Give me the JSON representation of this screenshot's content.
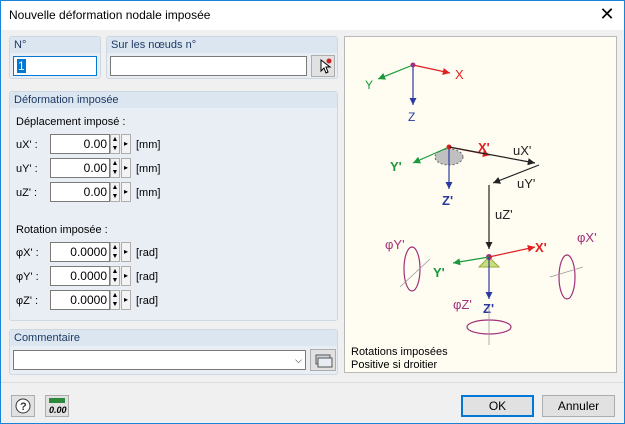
{
  "window": {
    "title": "Nouvelle déformation nodale imposée"
  },
  "no_group": {
    "label": "N°",
    "value": "1"
  },
  "nodes_group": {
    "label": "Sur les nœuds n°",
    "value": ""
  },
  "deformation_group": {
    "label": "Déformation imposée",
    "displacement_label": "Déplacement imposé :",
    "rotation_label": "Rotation imposée :",
    "rows": [
      {
        "symbol": "uX' :",
        "value": "0.00",
        "unit": "[mm]"
      },
      {
        "symbol": "uY' :",
        "value": "0.00",
        "unit": "[mm]"
      },
      {
        "symbol": "uZ' :",
        "value": "0.00",
        "unit": "[mm]"
      },
      {
        "symbol": "φX' :",
        "value": "0.0000",
        "unit": "[rad]"
      },
      {
        "symbol": "φY' :",
        "value": "0.0000",
        "unit": "[rad]"
      },
      {
        "symbol": "φZ' :",
        "value": "0.0000",
        "unit": "[rad]"
      }
    ]
  },
  "comment_group": {
    "label": "Commentaire",
    "value": ""
  },
  "diagram": {
    "axes_global": {
      "x": "X",
      "y": "Y",
      "z": "Z"
    },
    "axes_local": {
      "x": "X'",
      "y": "Y'",
      "z": "Z'"
    },
    "disp": {
      "ux": "uX'",
      "uy": "uY'",
      "uz": "uZ'"
    },
    "rot": {
      "phix": "φX'",
      "phiy": "φY'",
      "phiz": "φZ'"
    },
    "caption1": "Rotations imposées",
    "caption2": "Positive si droitier"
  },
  "footer": {
    "ok_label": "OK",
    "cancel_label": "Annuler",
    "units_icon_text": "0.00"
  },
  "colors": {
    "accent": "#0078d7",
    "x_axis": "#e02020",
    "y_axis": "#1a9a3a",
    "z_axis": "#2a3aa0",
    "rotation": "#a0307a"
  }
}
